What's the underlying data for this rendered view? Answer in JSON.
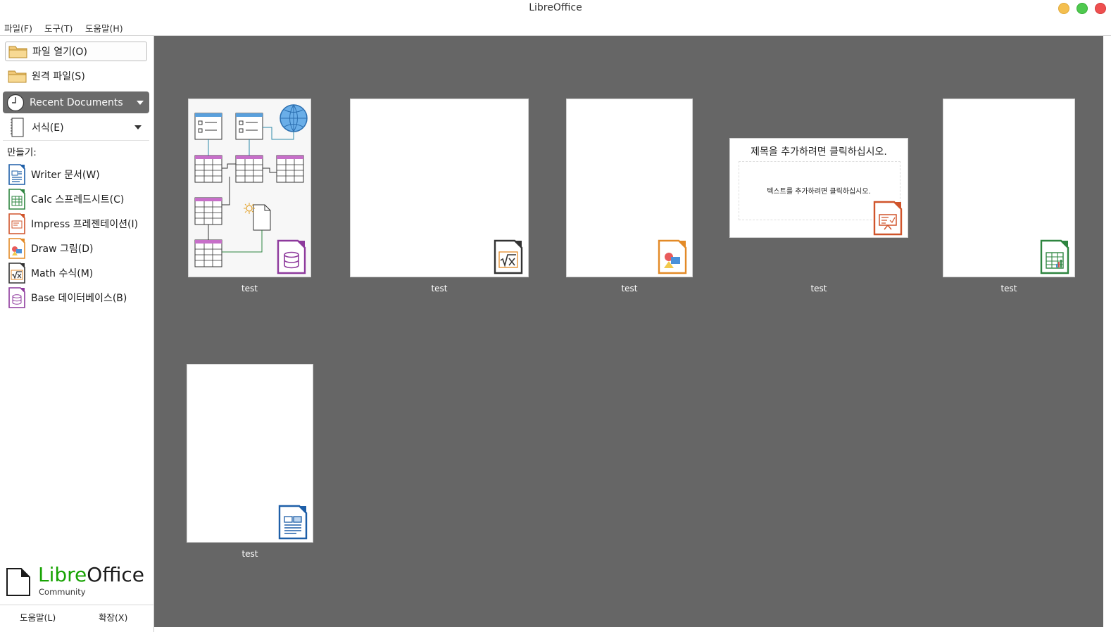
{
  "window": {
    "title": "LibreOffice"
  },
  "menu": {
    "items": [
      "파일(F)",
      "도구(T)",
      "도움말(H)"
    ]
  },
  "sidebar": {
    "open_file": "파일 열기(O)",
    "remote_files": "원격 파일(S)",
    "recent_documents": "Recent Documents",
    "templates": "서식(E)",
    "create_label": "만들기:",
    "create_items": [
      {
        "label": "Writer 문서(W)",
        "icon": "writer-icon",
        "color": "#1e5fa8"
      },
      {
        "label": "Calc 스프레드시트(C)",
        "icon": "calc-icon",
        "color": "#2e8540"
      },
      {
        "label": "Impress 프레젠테이션(I)",
        "icon": "impress-icon",
        "color": "#d0542b"
      },
      {
        "label": "Draw 그림(D)",
        "icon": "draw-icon",
        "color": "#e38a27"
      },
      {
        "label": "Math 수식(M)",
        "icon": "math-icon",
        "color": "#333333"
      },
      {
        "label": "Base 데이터베이스(B)",
        "icon": "base-icon",
        "color": "#8e3a9d"
      }
    ],
    "logo_libre": "Libre",
    "logo_office": "Office",
    "logo_sub": "Community",
    "help": "도움말(L)",
    "extensions": "확장(X)"
  },
  "recent": [
    {
      "label": "test",
      "type": "base"
    },
    {
      "label": "test",
      "type": "math"
    },
    {
      "label": "test",
      "type": "draw"
    },
    {
      "label": "test",
      "type": "impress",
      "slide_title": "제목을 추가하려면 클릭하십시오.",
      "slide_body": "텍스트를 추가하려면 클릭하십시오."
    },
    {
      "label": "test",
      "type": "calc"
    },
    {
      "label": "test",
      "type": "writer"
    }
  ],
  "colors": {
    "main_bg": "#666666",
    "libre_green": "#18a303",
    "sidebar_selected": "#6b6b6b"
  }
}
